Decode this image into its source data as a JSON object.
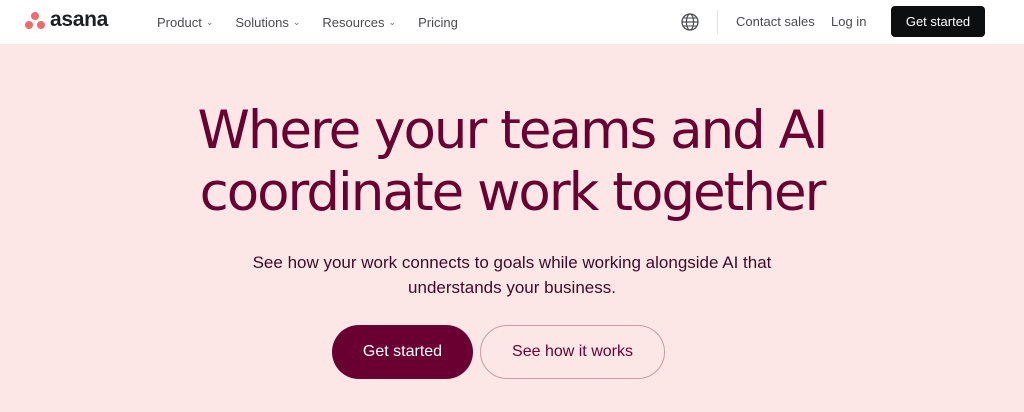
{
  "brand": {
    "name": "asana",
    "logo_icon": "asana-dots-icon",
    "logo_color": "#f06a6a"
  },
  "nav": {
    "items": [
      {
        "label": "Product",
        "has_dropdown": true
      },
      {
        "label": "Solutions",
        "has_dropdown": true
      },
      {
        "label": "Resources",
        "has_dropdown": true
      },
      {
        "label": "Pricing",
        "has_dropdown": false
      }
    ],
    "language_icon": "globe-icon",
    "contact_label": "Contact sales",
    "login_label": "Log in",
    "cta_label": "Get started"
  },
  "hero": {
    "title_line1": "Where your teams and AI",
    "title_line2": "coordinate work together",
    "subtitle_line1": "See how your work connects to goals while working alongside AI that",
    "subtitle_line2": "understands your business.",
    "primary_cta": "Get started",
    "secondary_cta": "See how it works"
  },
  "colors": {
    "background": "#fde7e6",
    "accent": "#690031",
    "nav_cta": "#0d0e10"
  }
}
